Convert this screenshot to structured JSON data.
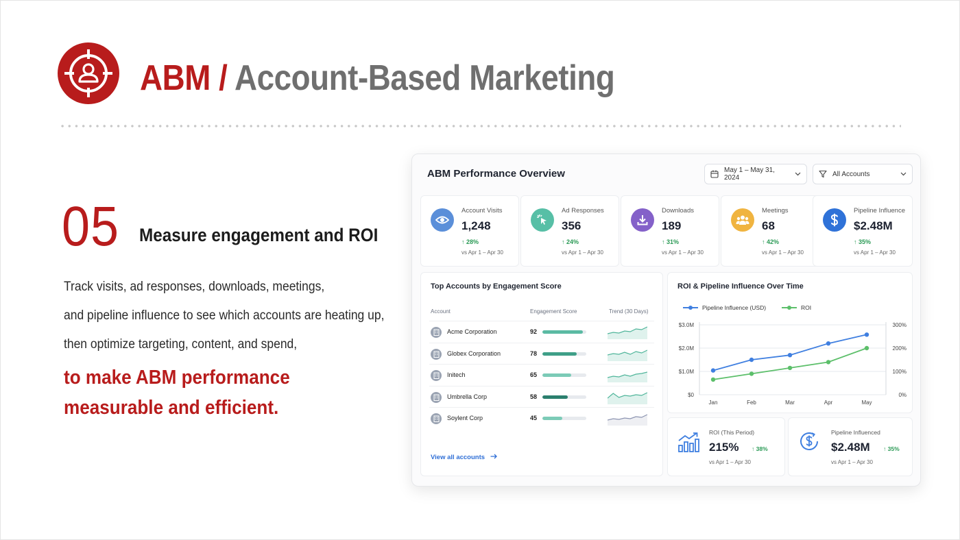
{
  "header": {
    "title_abbr": "ABM",
    "title_sep": " / ",
    "title_full": "Account-Based Marketing",
    "logo_icon": "target-user-icon"
  },
  "step": {
    "number": "05",
    "title": "Measure engagement and ROI",
    "body": [
      "Track visits, ad responses, downloads, meetings,",
      "and pipeline influence to see which accounts are heating up,",
      "then optimize targeting, content, and spend,"
    ],
    "highlight": [
      "to make ABM performance",
      "measurable and efficient."
    ]
  },
  "dashboard": {
    "title": "ABM Performance Overview",
    "date_range": "May 1 – May 31, 2024",
    "account_filter": "All Accounts",
    "kpis": [
      {
        "label": "Account Visits",
        "value": "1,248",
        "change": "↑ 28%",
        "compare": "vs Apr 1 – Apr 30",
        "icon": "eye-icon",
        "color": "#5b8fd9"
      },
      {
        "label": "Ad Responses",
        "value": "356",
        "change": "↑ 24%",
        "compare": "vs Apr 1 – Apr 30",
        "icon": "cursor-click-icon",
        "color": "#57bfa6"
      },
      {
        "label": "Downloads",
        "value": "189",
        "change": "↑ 31%",
        "compare": "vs Apr 1 – Apr 30",
        "icon": "download-icon",
        "color": "#8461c9"
      },
      {
        "label": "Meetings",
        "value": "68",
        "change": "↑ 42%",
        "compare": "vs Apr 1 – Apr 30",
        "icon": "people-icon",
        "color": "#f0b440"
      },
      {
        "label": "Pipeline Influence",
        "value": "$2.48M",
        "change": "↑ 35%",
        "compare": "vs Apr 1 – Apr 30",
        "icon": "dollar-icon",
        "color": "#2f72d8"
      }
    ],
    "top_accounts": {
      "title": "Top Accounts by Engagement Score",
      "columns": [
        "Account",
        "Engagement Score",
        "Trend (30 Days)"
      ],
      "rows": [
        {
          "name": "Acme Corporation",
          "score": 92
        },
        {
          "name": "Globex Corporation",
          "score": 78
        },
        {
          "name": "Initech",
          "score": 65
        },
        {
          "name": "Umbrella Corp",
          "score": 58
        },
        {
          "name": "Soylent Corp",
          "score": 45
        }
      ],
      "view_all": "View all accounts"
    },
    "roi_chart": {
      "title": "ROI & Pipeline Influence Over Time",
      "legend": [
        "Pipeline Influence (USD)",
        "ROI"
      ],
      "colors": {
        "pipeline": "#3f7fe0",
        "roi": "#5cbf6a"
      }
    },
    "roi_summary": {
      "label": "ROI (This Period)",
      "value": "215%",
      "change": "↑ 38%",
      "compare": "vs Apr 1 – Apr 30",
      "icon": "bar-chart-up-icon"
    },
    "pipeline_summary": {
      "label": "Pipeline Influenced",
      "value": "$2.48M",
      "change": "↑ 35%",
      "compare": "vs Apr 1 – Apr 30",
      "icon": "dollar-circle-icon"
    }
  },
  "chart_data": {
    "type": "line",
    "title": "ROI & Pipeline Influence Over Time",
    "x": [
      "Jan",
      "Feb",
      "Mar",
      "Apr",
      "May"
    ],
    "series": [
      {
        "name": "Pipeline Influence (USD)",
        "values": [
          1.04,
          1.5,
          1.7,
          2.2,
          2.58
        ],
        "axis": "left"
      },
      {
        "name": "ROI",
        "values": [
          65,
          90,
          115,
          140,
          200
        ],
        "axis": "right"
      }
    ],
    "ylim_left": [
      0,
      3.0
    ],
    "yticks_left": [
      "$0",
      "$1.0M",
      "$2.0M",
      "$3.0M"
    ],
    "ylim_right": [
      0,
      300
    ],
    "yticks_right": [
      "0%",
      "100%",
      "200%",
      "300%"
    ],
    "grid": true,
    "legend": "top-left"
  }
}
